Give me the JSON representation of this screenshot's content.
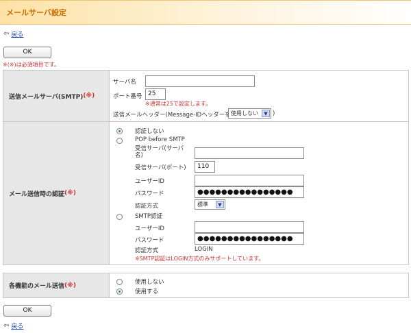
{
  "page": {
    "title": "メールサーバ設定",
    "back_label": "戻る",
    "ok_label": "OK",
    "required_note": "※(※)は必須項目です。"
  },
  "smtp": {
    "label": "送信メールサーバ(SMTP)",
    "required_mark": "(※)",
    "server_name_label": "サーバ名",
    "server_name_value": "",
    "port_label": "ポート番号",
    "port_value": "25",
    "port_note": "※通常は25で設定します。",
    "header_label_prefix": "送信メールヘッダー(Message-IDヘッダーを",
    "header_value": "使用しない",
    "header_label_suffix": ")"
  },
  "auth": {
    "label": "メール送信時の認証",
    "required_mark": "(※)",
    "option_none": "認証しない",
    "option_pop": "POP before SMTP",
    "pop_server_label": "受信サーバ(サーバ名)",
    "pop_server_value": "",
    "pop_port_label": "受信サーバ(ポート)",
    "pop_port_value": "110",
    "pop_user_label": "ユーザーID",
    "pop_user_value": "",
    "pop_password_label": "パスワード",
    "pop_password_value": "●●●●●●●●●●●●●●●●",
    "pop_method_label": "認証方式",
    "pop_method_value": "標準",
    "option_smtp": "SMTP認証",
    "smtp_user_label": "ユーザーID",
    "smtp_user_value": "",
    "smtp_password_label": "パスワード",
    "smtp_password_value": "●●●●●●●●●●●●●●●●",
    "smtp_method_label": "認証方式",
    "smtp_method_value": "LOGIN",
    "smtp_note": "※SMTP認証はLOGIN方式のみサポートしています。",
    "selected": "none"
  },
  "feature_mail": {
    "label": "各機能のメール送信",
    "required_mark": "(※)",
    "option_off": "使用しない",
    "option_on": "使用する",
    "selected": "on"
  },
  "icons": {
    "back": "arrow-left-icon",
    "dropdown": "chevron-down-icon"
  },
  "colors": {
    "title": "#cc6a00",
    "required": "#cc3333",
    "link": "#1a3fb0",
    "label_bg": "#e7e7e7"
  }
}
